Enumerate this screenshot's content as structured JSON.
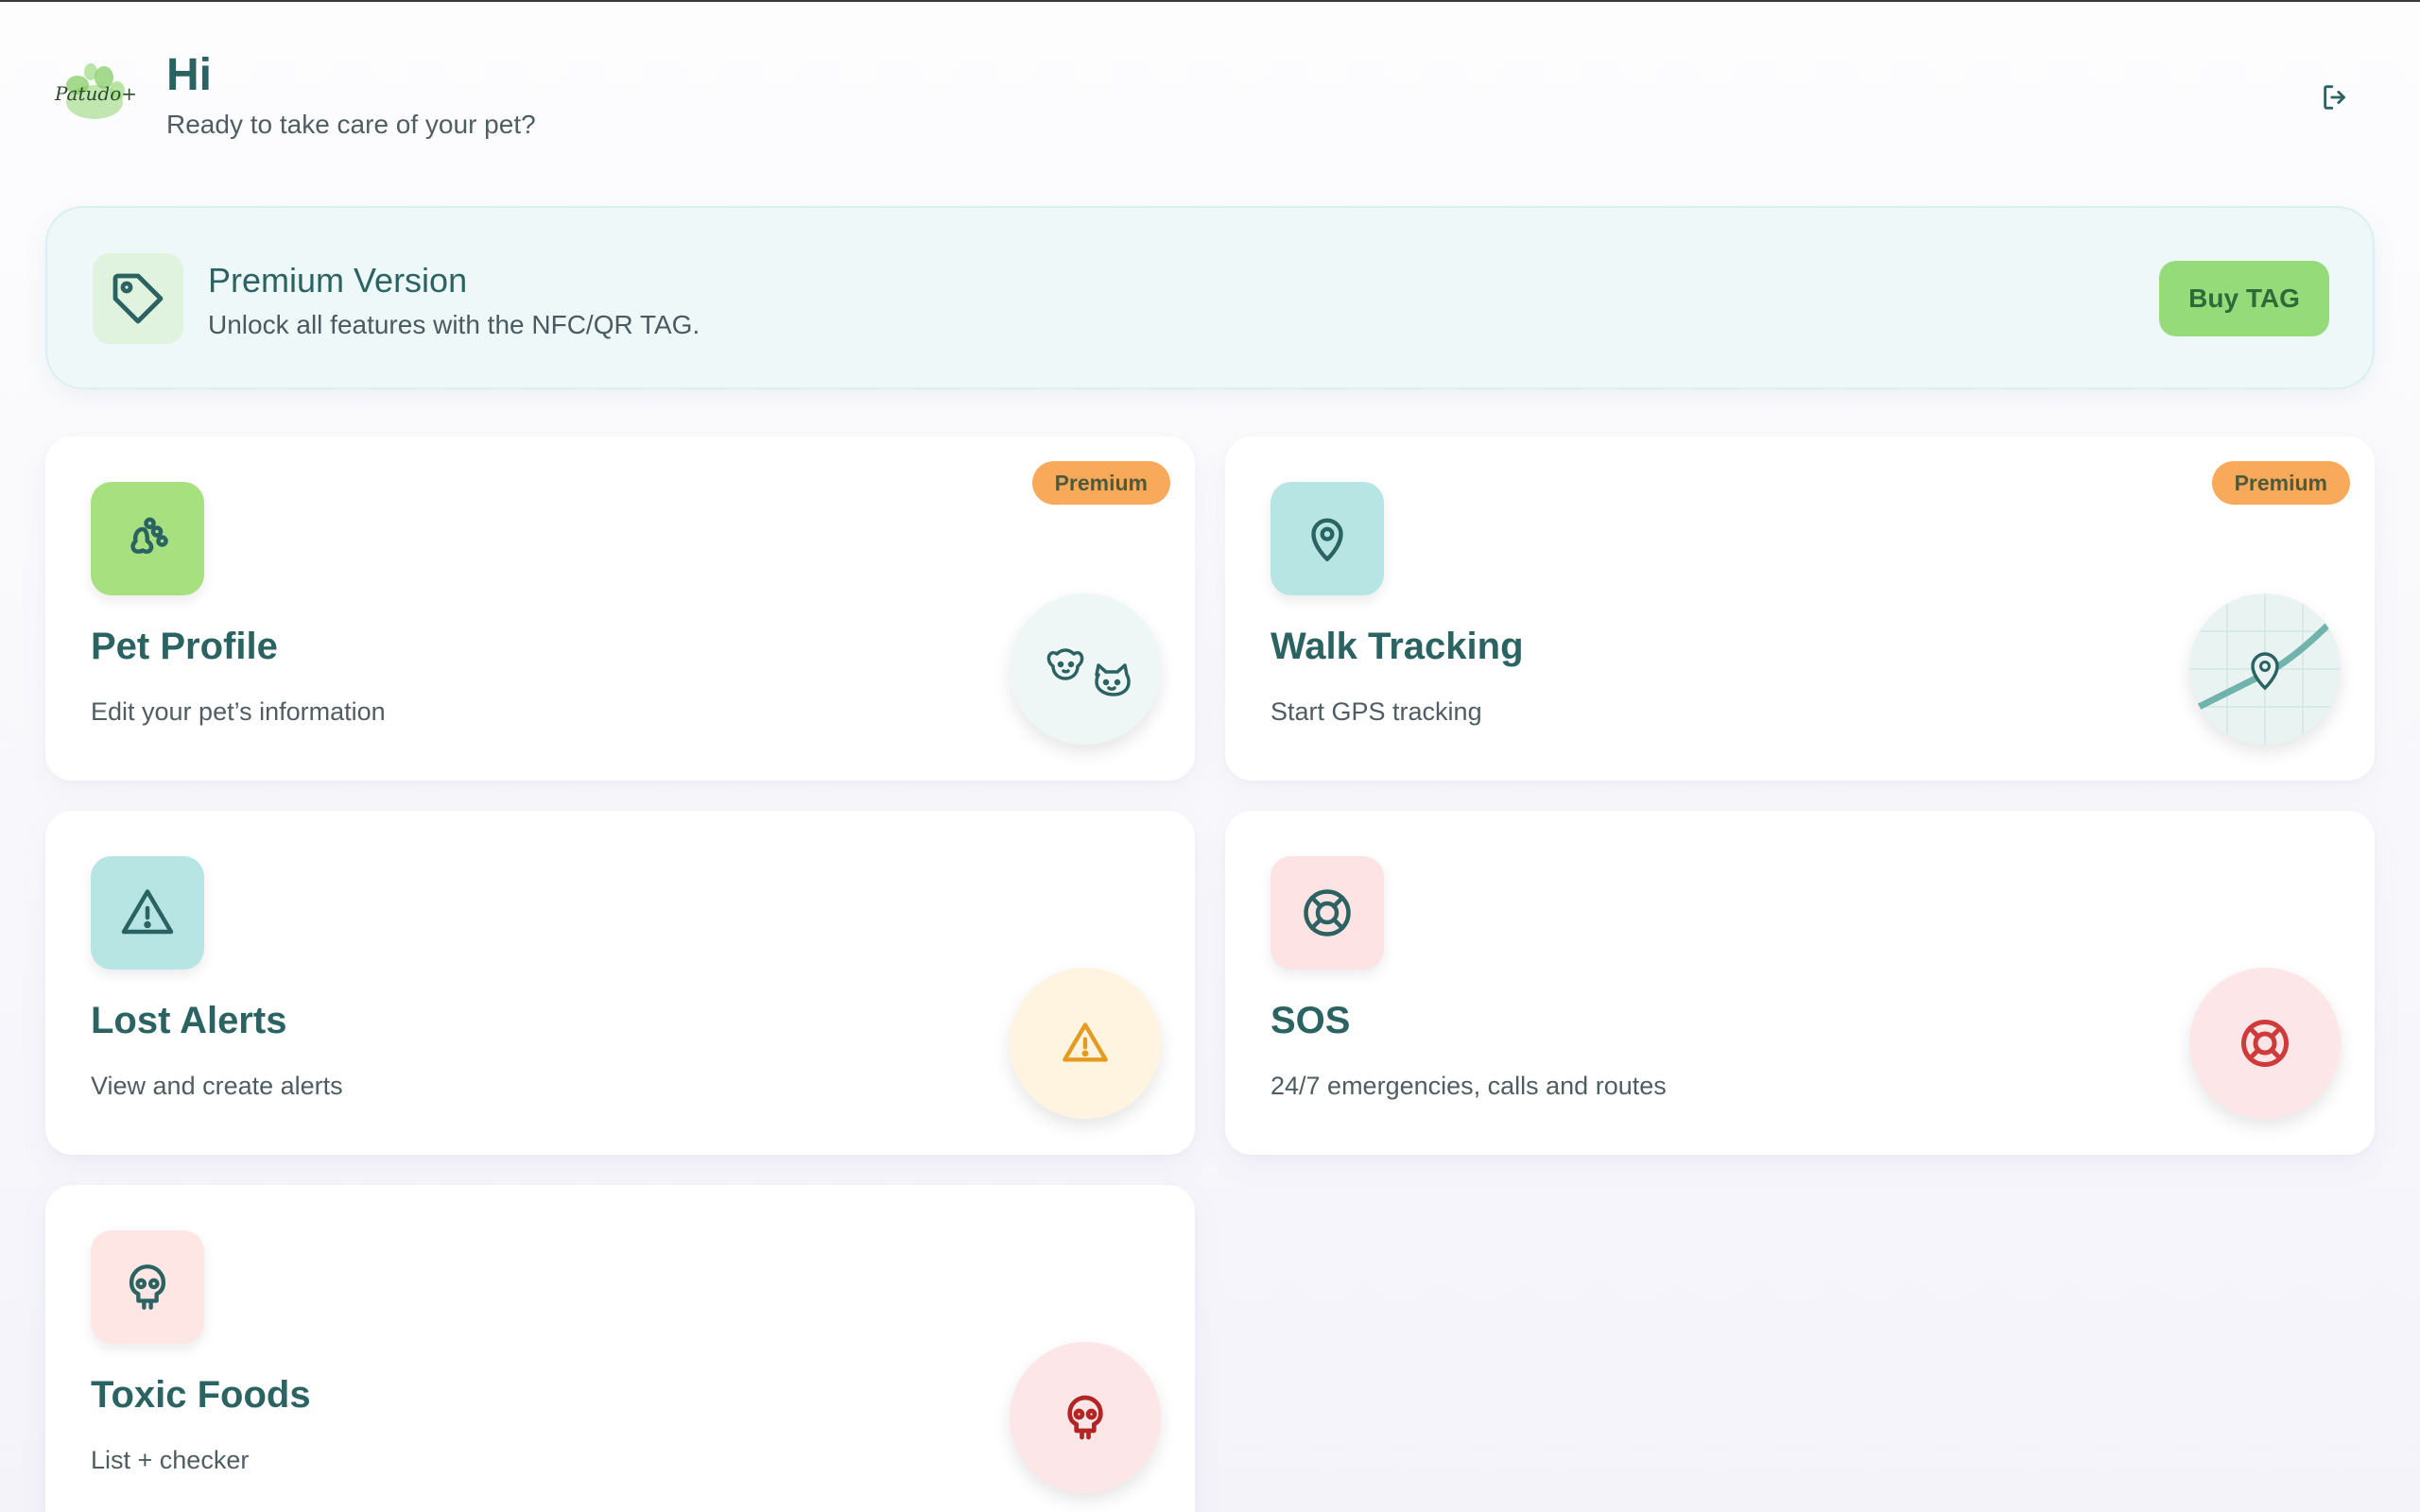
{
  "header": {
    "logo_text": "Patudo+",
    "greeting": "Hi",
    "subtitle": "Ready to take care of your pet?",
    "logout_icon": "logout-icon"
  },
  "banner": {
    "icon": "tag-icon",
    "title": "Premium Version",
    "subtitle": "Unlock all features with the NFC/QR TAG.",
    "button_label": "Buy TAG"
  },
  "cards": [
    {
      "title": "Pet Profile",
      "subtitle": "Edit your pet’s information",
      "badge": "Premium",
      "icon": "paw-icon",
      "illustration": "dog-cat-icon",
      "icon_bg": "#a6e07f",
      "circle_bg": "#eef7f5"
    },
    {
      "title": "Walk Tracking",
      "subtitle": "Start GPS tracking",
      "badge": "Premium",
      "icon": "map-pin-icon",
      "illustration": "map-route-icon",
      "icon_bg": "#b7e5e3",
      "circle_bg": "#e8f3f2"
    },
    {
      "title": "Lost Alerts",
      "subtitle": "View and create alerts",
      "badge": "",
      "icon": "alert-triangle-icon",
      "illustration": "alert-triangle-icon",
      "icon_bg": "#b7e5e3",
      "circle_bg": "#fff4df"
    },
    {
      "title": "SOS",
      "subtitle": "24/7 emergencies, calls and routes",
      "badge": "",
      "icon": "lifebuoy-icon",
      "illustration": "lifebuoy-icon",
      "icon_bg": "#fde3e4",
      "circle_bg": "#fde6e7"
    },
    {
      "title": "Toxic Foods",
      "subtitle": "List + checker",
      "badge": "",
      "icon": "skull-icon",
      "illustration": "skull-icon",
      "icon_bg": "#fde6e3",
      "circle_bg": "#fde6e7"
    }
  ],
  "colors": {
    "accent": "#2b6362",
    "buy_button": "#96db79",
    "premium_badge": "#f8a95a",
    "alert_orange": "#e49a1f",
    "sos_red": "#cf3a3a",
    "toxic_red": "#b22525"
  }
}
